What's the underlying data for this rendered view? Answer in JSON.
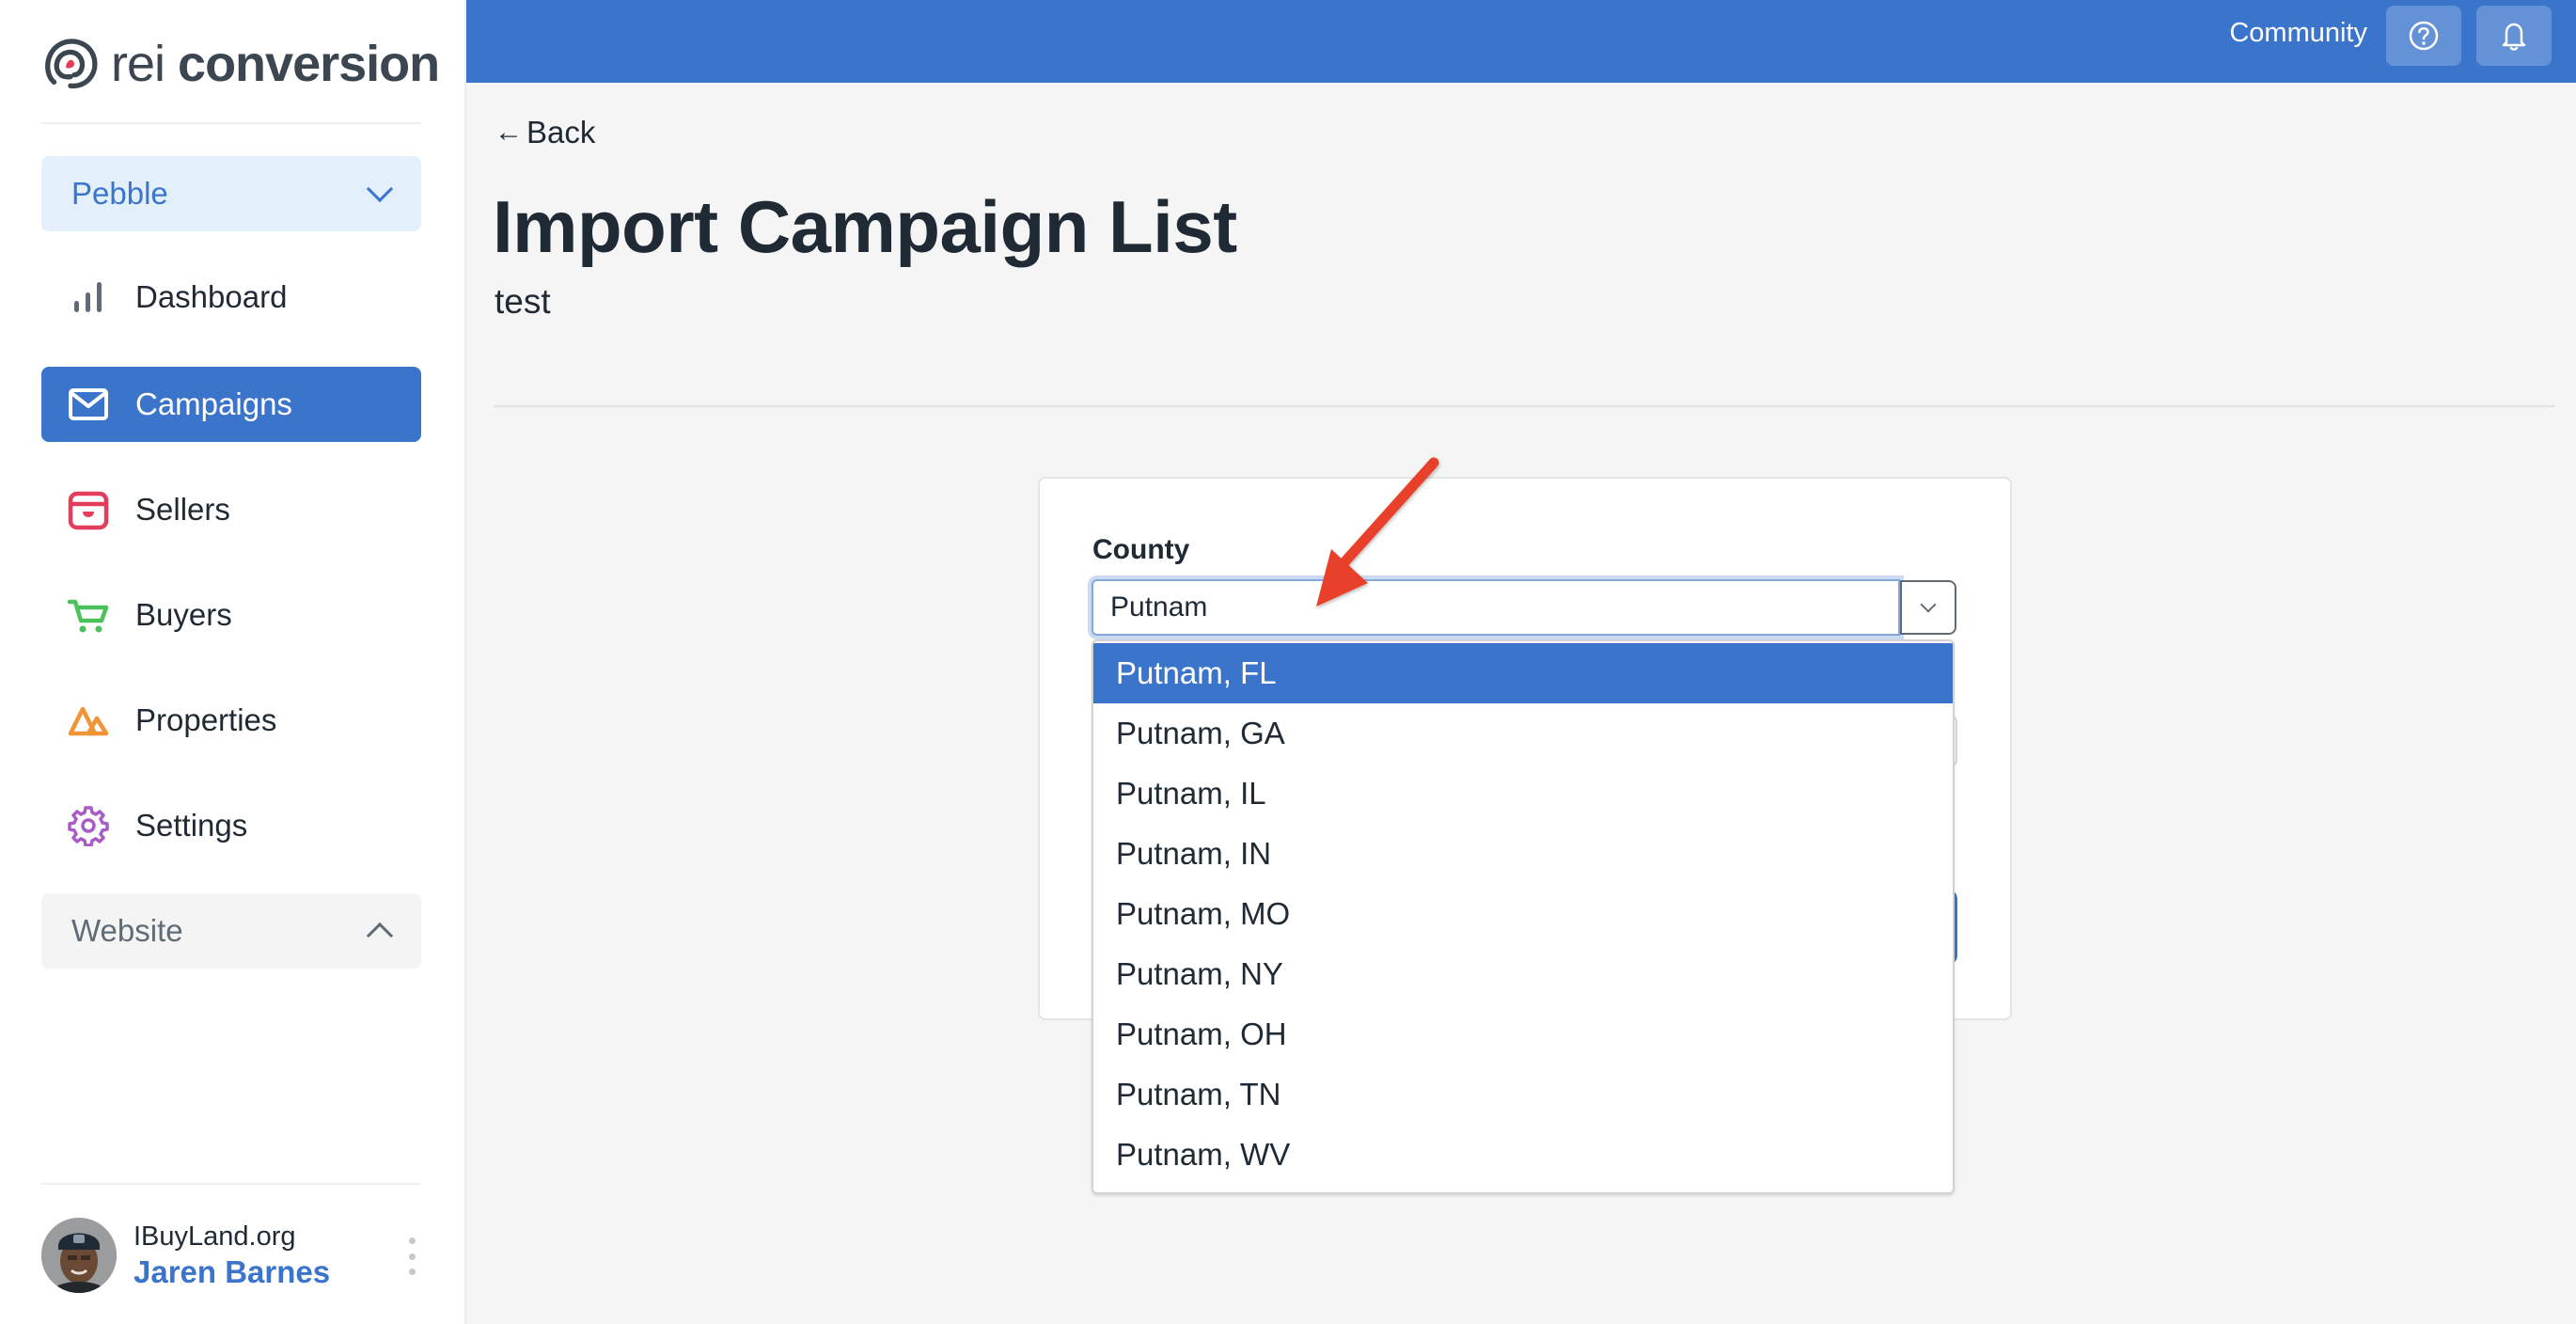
{
  "brand": {
    "name_light": "rei",
    "name_bold": "conversion",
    "accent": "#3a75cb",
    "logo_dot_color": "#e43d5c"
  },
  "account_switcher": {
    "label": "Pebble",
    "icon": "chevron-down-icon"
  },
  "sidebar": {
    "items": [
      {
        "label": "Dashboard",
        "icon": "bar-chart-icon",
        "color": "#5f6b76",
        "active": false
      },
      {
        "label": "Campaigns",
        "icon": "envelope-icon",
        "color": "#ffffff",
        "active": true
      },
      {
        "label": "Sellers",
        "icon": "shopping-bag-icon",
        "color": "#e43d5c",
        "active": false
      },
      {
        "label": "Buyers",
        "icon": "cart-icon",
        "color": "#4cc25c",
        "active": false
      },
      {
        "label": "Properties",
        "icon": "mountains-icon",
        "color": "#f09436",
        "active": false
      },
      {
        "label": "Settings",
        "icon": "gear-icon",
        "color": "#a85cc5",
        "active": false
      }
    ],
    "group": {
      "label": "Website",
      "icon": "chevron-up-icon",
      "expanded": true
    }
  },
  "user": {
    "org": "IBuyLand.org",
    "name": "Jaren Barnes",
    "menu_icon": "kebab-menu-icon"
  },
  "topbar": {
    "community_label": "Community",
    "help_icon": "help-circle-icon",
    "bell_icon": "bell-icon",
    "color": "#3a75cb"
  },
  "page": {
    "back_label": "Back",
    "title": "Import Campaign List",
    "subtitle": "test"
  },
  "form": {
    "county": {
      "label": "County",
      "value": "Putnam",
      "options": [
        "Putnam, FL",
        "Putnam, GA",
        "Putnam, IL",
        "Putnam, IN",
        "Putnam, MO",
        "Putnam, NY",
        "Putnam, OH",
        "Putnam, TN",
        "Putnam, WV"
      ],
      "highlighted_index": 0
    }
  },
  "annotation": {
    "type": "arrow",
    "color": "#e8412b",
    "points_to": "county-input"
  }
}
